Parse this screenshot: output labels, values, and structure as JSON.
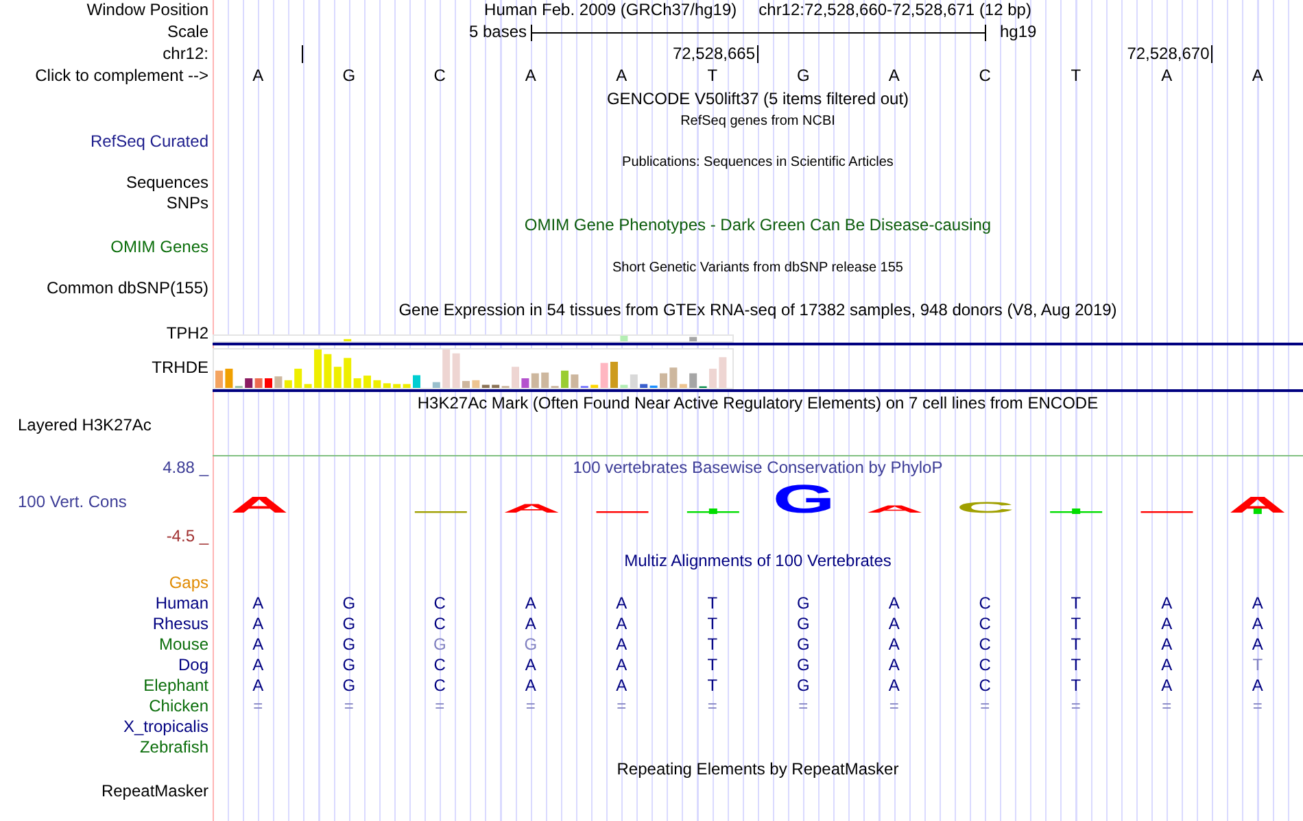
{
  "header": {
    "label": "Window Position",
    "assembly": "Human Feb. 2009 (GRCh37/hg19)",
    "position": "chr12:72,528,660-72,528,671 (12 bp)"
  },
  "scale": {
    "label": "Scale",
    "span": "5 bases",
    "assembly": "hg19"
  },
  "ruler": {
    "label": "chr12:",
    "ticks": [
      {
        "label": "72,528,665"
      },
      {
        "label": "72,528,670"
      }
    ]
  },
  "sequence": {
    "label": "Click to complement -->",
    "bases": [
      "A",
      "G",
      "C",
      "A",
      "A",
      "T",
      "G",
      "A",
      "C",
      "T",
      "A",
      "A"
    ]
  },
  "tracks": [
    {
      "kind": "title",
      "text": "GENCODE V50lift37 (5 items filtered out)",
      "color": "#000000"
    },
    {
      "kind": "subtitle",
      "text": "RefSeq genes from NCBI",
      "color": "#000000"
    },
    {
      "kind": "label",
      "text": "RefSeq Curated",
      "color": "#1c1c8c"
    },
    {
      "kind": "subtitle",
      "text": "Publications: Sequences in Scientific Articles",
      "color": "#000000"
    },
    {
      "kind": "label",
      "text": "Sequences",
      "color": "#000000"
    },
    {
      "kind": "label",
      "text": "SNPs",
      "color": "#000000"
    },
    {
      "kind": "title",
      "text": "OMIM Gene Phenotypes - Dark Green Can Be Disease-causing",
      "color": "#0b5c0b"
    },
    {
      "kind": "label",
      "text": "OMIM Genes",
      "color": "#0b6e0b"
    },
    {
      "kind": "subtitle",
      "text": "Short Genetic Variants from dbSNP release 155",
      "color": "#000000"
    },
    {
      "kind": "label",
      "text": "Common dbSNP(155)",
      "color": "#000000"
    },
    {
      "kind": "title",
      "text": "Gene Expression in 54 tissues from GTEx RNA-seq of 17382 samples, 948 donors (V8, Aug 2019)",
      "color": "#000000"
    },
    {
      "kind": "compact-expression",
      "text": "TPH2",
      "color": "#000000"
    },
    {
      "kind": "expression",
      "text": "TRHDE",
      "color": "#000000"
    },
    {
      "kind": "title",
      "text": "H3K27Ac Mark (Often Found Near Active Regulatory Elements) on 7 cell lines from ENCODE",
      "color": "#000000"
    },
    {
      "kind": "signal",
      "text": "Layered H3K27Ac",
      "color": "#000000"
    },
    {
      "kind": "conservation",
      "title": "100 vertebrates Basewise Conservation by PhyloP",
      "label": "100 Vert. Cons",
      "max": "4.88 _",
      "min": "-4.5 _",
      "color": "#3c3c96",
      "logo": [
        {
          "kind": "letter",
          "letter": "A",
          "color": "#ff0000",
          "marker": false
        },
        {
          "kind": "empty"
        },
        {
          "kind": "line",
          "color": "#a0a000",
          "marker": false
        },
        {
          "kind": "letter",
          "letter": "A",
          "color": "#ff0000",
          "marker": false
        },
        {
          "kind": "line",
          "color": "#ff0000",
          "marker": false
        },
        {
          "kind": "line",
          "color": "#00dd00",
          "marker": true
        },
        {
          "kind": "letter",
          "letter": "G",
          "color": "#0000ff",
          "marker": false
        },
        {
          "kind": "letter",
          "letter": "A",
          "color": "#ff0000",
          "marker": false
        },
        {
          "kind": "letter",
          "letter": "C",
          "color": "#a0a000",
          "marker": false
        },
        {
          "kind": "line",
          "color": "#00dd00",
          "marker": true
        },
        {
          "kind": "line",
          "color": "#ff0000",
          "marker": false
        },
        {
          "kind": "letter",
          "letter": "A",
          "color": "#ff0000",
          "marker": true
        }
      ]
    },
    {
      "kind": "title",
      "text": "Multiz Alignments of 100 Vertebrates",
      "color": "#000080"
    },
    {
      "kind": "species",
      "text": "Gaps",
      "color": "#e08a00"
    },
    {
      "kind": "species",
      "text": "Human",
      "color": "#000080",
      "bases": [
        "A",
        "G",
        "C",
        "A",
        "A",
        "T",
        "G",
        "A",
        "C",
        "T",
        "A",
        "A"
      ],
      "differs": [
        false,
        false,
        false,
        false,
        false,
        false,
        false,
        false,
        false,
        false,
        false,
        false
      ]
    },
    {
      "kind": "species",
      "text": "Rhesus",
      "color": "#000080",
      "bases": [
        "A",
        "G",
        "C",
        "A",
        "A",
        "T",
        "G",
        "A",
        "C",
        "T",
        "A",
        "A"
      ],
      "differs": [
        false,
        false,
        false,
        false,
        false,
        false,
        false,
        false,
        false,
        false,
        false,
        false
      ]
    },
    {
      "kind": "species",
      "text": "Mouse",
      "color": "#0b6e0b",
      "bases": [
        "A",
        "G",
        "G",
        "G",
        "A",
        "T",
        "G",
        "A",
        "C",
        "T",
        "A",
        "A"
      ],
      "differs": [
        false,
        false,
        true,
        true,
        false,
        false,
        false,
        false,
        false,
        false,
        false,
        false
      ]
    },
    {
      "kind": "species",
      "text": "Dog",
      "color": "#000080",
      "bases": [
        "A",
        "G",
        "C",
        "A",
        "A",
        "T",
        "G",
        "A",
        "C",
        "T",
        "A",
        "T"
      ],
      "differs": [
        false,
        false,
        false,
        false,
        false,
        false,
        false,
        false,
        false,
        false,
        false,
        true
      ]
    },
    {
      "kind": "species",
      "text": "Elephant",
      "color": "#0b6e0b",
      "bases": [
        "A",
        "G",
        "C",
        "A",
        "A",
        "T",
        "G",
        "A",
        "C",
        "T",
        "A",
        "A"
      ],
      "differs": [
        false,
        false,
        false,
        false,
        false,
        false,
        false,
        false,
        false,
        false,
        false,
        false
      ]
    },
    {
      "kind": "species",
      "text": "Chicken",
      "color": "#0b6e0b",
      "bases": [
        "=",
        "=",
        "=",
        "=",
        "=",
        "=",
        "=",
        "=",
        "=",
        "=",
        "=",
        "="
      ],
      "differs": [
        true,
        true,
        true,
        true,
        true,
        true,
        true,
        true,
        true,
        true,
        true,
        true
      ]
    },
    {
      "kind": "species",
      "text": "X_tropicalis",
      "color": "#000080"
    },
    {
      "kind": "species",
      "text": "Zebrafish",
      "color": "#0b6e0b"
    },
    {
      "kind": "title",
      "text": "Repeating Elements by RepeatMasker",
      "color": "#000000"
    },
    {
      "kind": "label",
      "text": "RepeatMasker",
      "color": "#000000"
    }
  ]
}
